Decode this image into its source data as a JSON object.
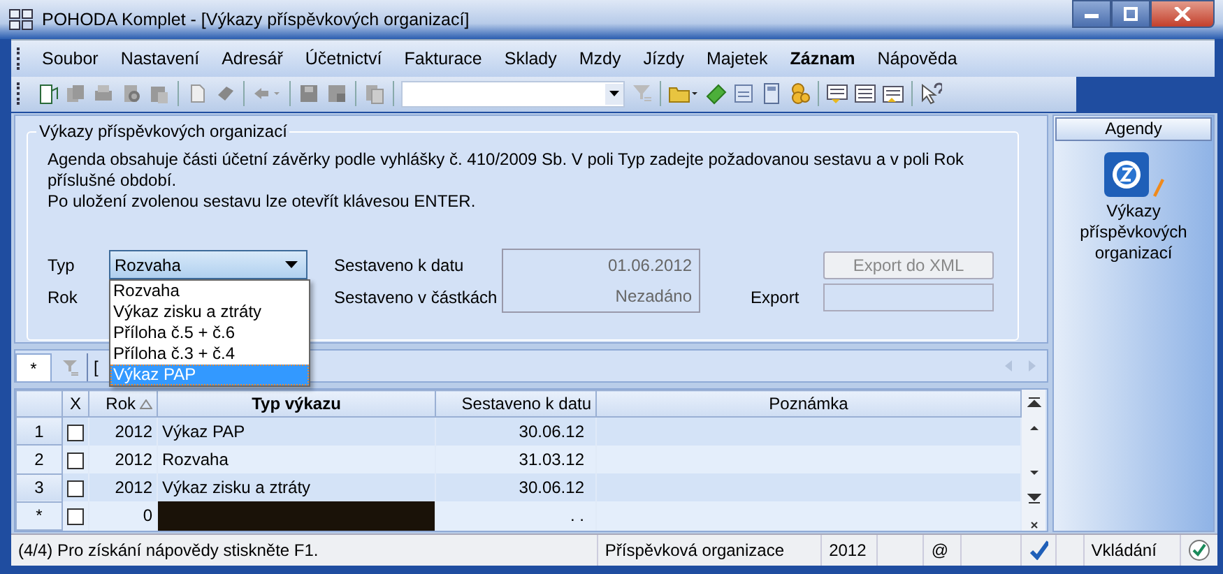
{
  "window": {
    "title": "POHODA Komplet - [Výkazy příspěvkových organizací]"
  },
  "menu": [
    {
      "label": "Soubor",
      "bold": false
    },
    {
      "label": "Nastavení",
      "bold": false
    },
    {
      "label": "Adresář",
      "bold": false
    },
    {
      "label": "Účetnictví",
      "bold": false
    },
    {
      "label": "Fakturace",
      "bold": false
    },
    {
      "label": "Sklady",
      "bold": false
    },
    {
      "label": "Mzdy",
      "bold": false
    },
    {
      "label": "Jízdy",
      "bold": false
    },
    {
      "label": "Majetek",
      "bold": false
    },
    {
      "label": "Záznam",
      "bold": true
    },
    {
      "label": "Nápověda",
      "bold": false
    }
  ],
  "form": {
    "title": "Výkazy příspěvkových organizací",
    "description": [
      "Agenda obsahuje části účetní závěrky podle vyhlášky č. 410/2009 Sb. V poli Typ zadejte požadovanou sestavu a v poli Rok",
      "příslušné období.",
      "Po uložení zvolenou sestavu lze otevřít klávesou ENTER."
    ],
    "typ_label": "Typ",
    "typ_value": "Rozvaha",
    "rok_label": "Rok",
    "dropdown": [
      {
        "label": "Rozvaha",
        "selected": false
      },
      {
        "label": "Výkaz zisku a ztráty",
        "selected": false
      },
      {
        "label": "Příloha č.5 + č.6",
        "selected": false
      },
      {
        "label": "Příloha č.3 + č.4",
        "selected": false
      },
      {
        "label": "Výkaz PAP",
        "selected": true
      }
    ],
    "date_label": "Sestaveno k datu",
    "date_value": "01.06.2012",
    "amount_label": "Sestaveno v částkách",
    "amount_value": "Nezadáno",
    "export_button": {
      "label": "Export do XML",
      "disabled": true
    },
    "export_label": "Export"
  },
  "tabs": [
    {
      "label": "*",
      "kind": "text",
      "selected": true
    },
    {
      "kind": "filter",
      "selected": false
    },
    {
      "label": "[",
      "kind": "text",
      "selected": false
    }
  ],
  "table": {
    "columns": [
      "X",
      "Rok",
      "Typ výkazu",
      "Sestaveno k datu",
      "Poznámka"
    ],
    "rows": [
      {
        "number": "1",
        "checked": false,
        "rok": "2012",
        "typ": "Výkaz PAP",
        "datum": "30.06.12"
      },
      {
        "number": "2",
        "checked": false,
        "rok": "2012",
        "typ": "Rozvaha",
        "datum": "31.03.12"
      },
      {
        "number": "3",
        "checked": false,
        "rok": "2012",
        "typ": "Výkaz zisku a ztráty",
        "datum": "30.06.12"
      },
      {
        "number": "*",
        "checked": false,
        "rok": "0",
        "typ_editing": true,
        "datum": ". ."
      }
    ]
  },
  "sidebar": {
    "title": "Agendy",
    "item": "Výkazy příspěvkových organizací"
  },
  "status_bar": [
    "(4/4) Pro získání nápovědy stiskněte F1.",
    "Příspěvková organizace",
    "2012",
    "@",
    "Vkládání"
  ]
}
